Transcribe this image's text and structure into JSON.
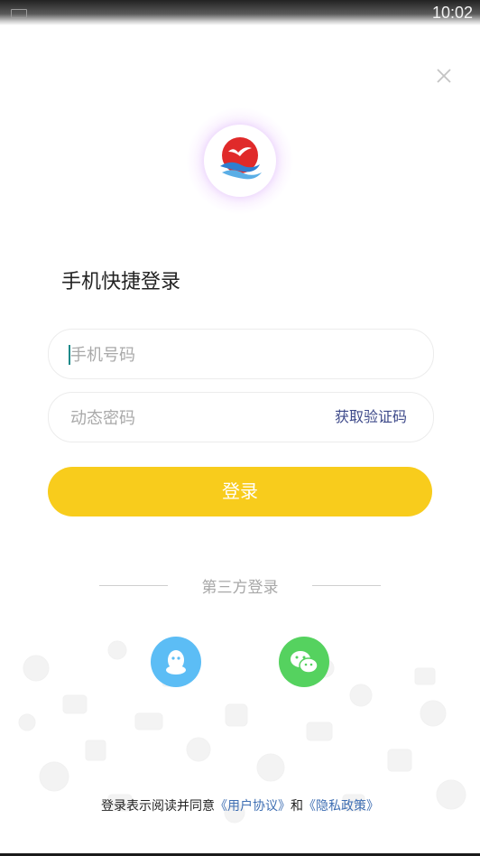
{
  "status_bar": {
    "time": "10:02",
    "keyboard_icon": "keyboard-icon"
  },
  "close_icon": "close-icon",
  "logo": {
    "icon": "seagull-sun-wave-logo",
    "sun_color": "#e02a2a",
    "wave_color": "#2f7fd0"
  },
  "page_title": "手机快捷登录",
  "phone_field": {
    "placeholder": "手机号码",
    "value": ""
  },
  "code_field": {
    "placeholder": "动态密码",
    "value": "",
    "get_code_label": "获取验证码"
  },
  "login_button": {
    "label": "登录",
    "color": "#f8cc1c"
  },
  "third_party": {
    "label": "第三方登录",
    "qq": {
      "icon": "qq-icon",
      "color": "#5cbdf5"
    },
    "wechat": {
      "icon": "wechat-icon",
      "color": "#55d25f"
    }
  },
  "agreement": {
    "prefix": "登录表示阅读并同意",
    "user_agreement": "《用户协议》",
    "conjunction": "和",
    "privacy_policy": "《隐私政策》"
  }
}
